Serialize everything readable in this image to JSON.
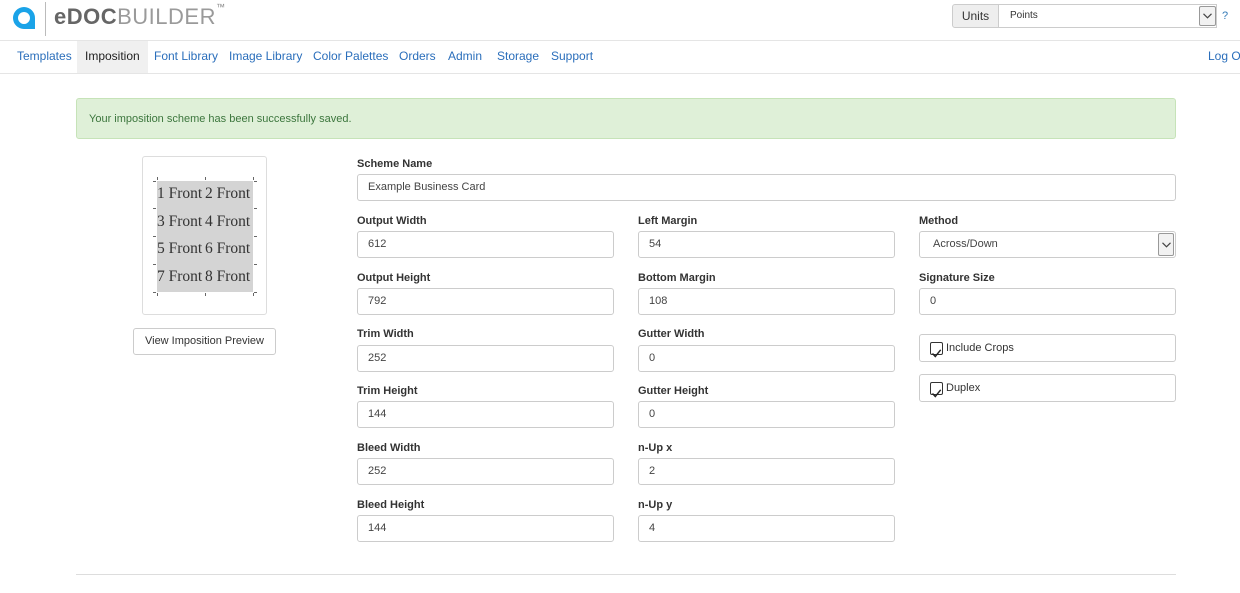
{
  "header": {
    "brand_bold": "eDOC",
    "brand_light": "BUILDER",
    "brand_tm": "™",
    "units_label": "Units",
    "units_value": "Points",
    "help_label": "?"
  },
  "nav": {
    "items": [
      {
        "label": "Templates"
      },
      {
        "label": "Imposition"
      },
      {
        "label": "Font Library"
      },
      {
        "label": "Image Library"
      },
      {
        "label": "Color Palettes"
      },
      {
        "label": "Orders"
      },
      {
        "label": "Admin"
      },
      {
        "label": "Storage"
      },
      {
        "label": "Support"
      }
    ],
    "active": "Imposition",
    "logout": "Log Out"
  },
  "alert": {
    "message": "Your imposition scheme has been successfully saved."
  },
  "preview": {
    "rows": [
      [
        "1 Front",
        "2 Front"
      ],
      [
        "3 Front",
        "4 Front"
      ],
      [
        "5 Front",
        "6 Front"
      ],
      [
        "7 Front",
        "8 Front"
      ]
    ],
    "button_label": "View Imposition Preview"
  },
  "form": {
    "scheme_name": {
      "label": "Scheme Name",
      "value": "Example Business Card"
    },
    "output_width": {
      "label": "Output Width",
      "value": "612"
    },
    "output_height": {
      "label": "Output Height",
      "value": "792"
    },
    "trim_width": {
      "label": "Trim Width",
      "value": "252"
    },
    "trim_height": {
      "label": "Trim Height",
      "value": "144"
    },
    "bleed_width": {
      "label": "Bleed Width",
      "value": "252"
    },
    "bleed_height": {
      "label": "Bleed Height",
      "value": "144"
    },
    "left_margin": {
      "label": "Left Margin",
      "value": "54"
    },
    "bottom_margin": {
      "label": "Bottom Margin",
      "value": "108"
    },
    "gutter_width": {
      "label": "Gutter Width",
      "value": "0"
    },
    "gutter_height": {
      "label": "Gutter Height",
      "value": "0"
    },
    "n_up_x": {
      "label": "n-Up x",
      "value": "2"
    },
    "n_up_y": {
      "label": "n-Up y",
      "value": "4"
    },
    "method": {
      "label": "Method",
      "value": "Across/Down"
    },
    "signature_size": {
      "label": "Signature Size",
      "value": "0"
    },
    "include_crops": {
      "label": "Include Crops",
      "checked": true
    },
    "duplex": {
      "label": "Duplex",
      "checked": true
    }
  },
  "colors": {
    "link": "#2a6ebb",
    "alert_bg": "#dff0d8",
    "alert_text": "#3c763d",
    "logo_blue": "#1aa3e8"
  }
}
